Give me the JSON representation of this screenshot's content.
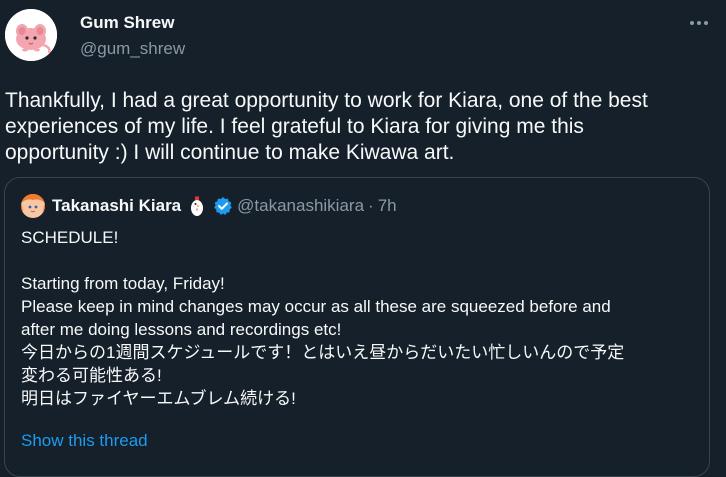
{
  "tweet": {
    "author": {
      "name": "Gum Shrew",
      "handle": "@gum_shrew",
      "avatar_icon": "pink-shrew-avatar"
    },
    "more_icon": "more-horizontal-icon",
    "text": "Thankfully, I had a great opportunity to work for Kiara, one of the best\nexperiences of my life. I feel grateful to Kiara for giving me this\nopportunity :) I will continue to make Kiwawa art."
  },
  "quote": {
    "author": {
      "name": "Takanashi Kiara",
      "emoji_icon": "chicken-emoji-icon",
      "verified_icon": "verified-badge-icon",
      "handle": "@takanashikiara",
      "separator": "·",
      "time": "7h",
      "avatar_icon": "kiara-avatar"
    },
    "text": "SCHEDULE!\n\nStarting from today, Friday!\nPlease keep in mind changes may occur as all these are squeezed before and\nafter me doing lessons and recordings etc!\n今日からの1週間スケジュールです！とはいえ昼からだいたい忙しいんので予定\n変わる可能性ある!\n明日はファイヤーエムブレム続ける!",
    "show_thread": "Show this thread"
  },
  "colors": {
    "background": "#15202b",
    "text_primary": "#f7f9f9",
    "text_secondary": "#8b98a5",
    "accent": "#1d9bf0",
    "border": "#38444d"
  }
}
